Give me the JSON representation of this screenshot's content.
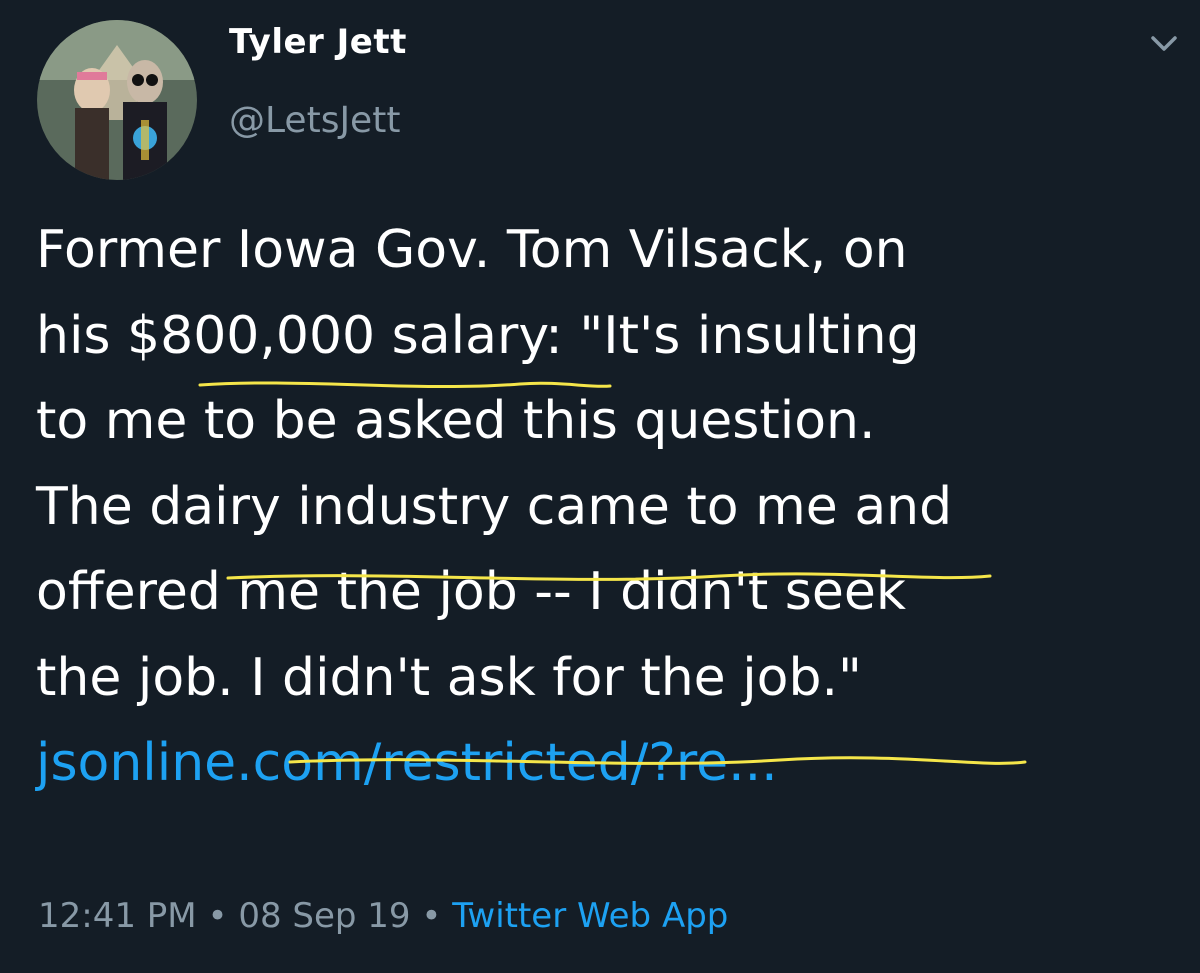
{
  "user": {
    "display_name": "Tyler Jett",
    "handle": "@LetsJett"
  },
  "tweet": {
    "lines": [
      "Former Iowa Gov. Tom Vilsack, on",
      "his $800,000 salary: \"It's insulting",
      "to me to be asked this question.",
      "The dairy industry came to me and",
      "offered me the job -- I didn't seek",
      "the job. I didn't ask for the job.\""
    ],
    "link_text": "jsonline.com/restricted/?re..."
  },
  "meta": {
    "time": "12:41 PM",
    "separator": "•",
    "date": "08 Sep 19",
    "source": "Twitter Web App"
  },
  "icons": {
    "menu": "chevron-down-icon"
  },
  "colors": {
    "background": "#141d26",
    "text": "#ffffff",
    "secondary": "#8899a6",
    "link": "#1da1f2",
    "highlight_underline": "#f5e64a"
  }
}
